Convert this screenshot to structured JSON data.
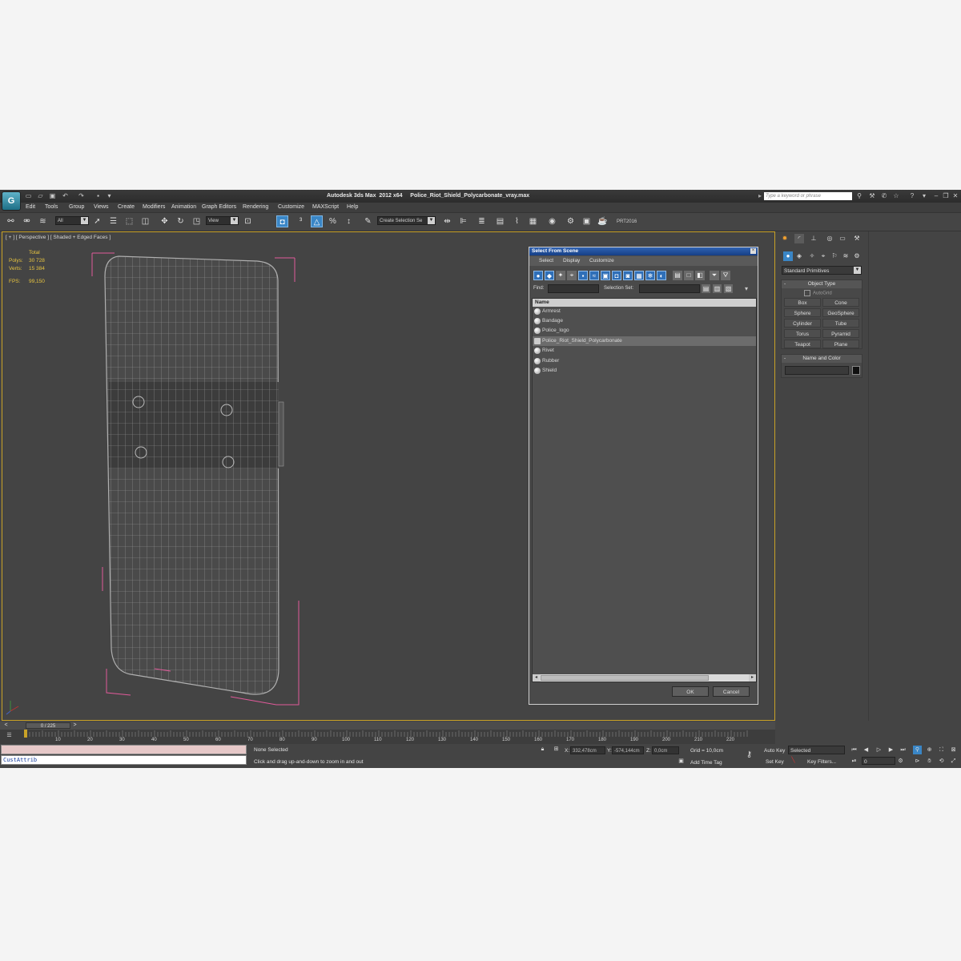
{
  "titlebar": {
    "app": "Autodesk 3ds Max  2012 x64",
    "file": "Police_Riot_Shield_Polycarbonate_vray.max",
    "search_placeholder": "Type a keyword or phrase"
  },
  "menu": [
    "Edit",
    "Tools",
    "Group",
    "Views",
    "Create",
    "Modifiers",
    "Animation",
    "Graph Editors",
    "Rendering",
    "Customize",
    "MAXScript",
    "Help"
  ],
  "toolbar": {
    "filter": "All",
    "ref_coord": "View",
    "named_selection": "Create Selection Se",
    "plugin_label": "PRT2016"
  },
  "viewport": {
    "label": "[ + ] [ Perspective ] [ Shaded + Edged Faces ]",
    "stats": {
      "total_label": "Total",
      "polys_label": "Polys:",
      "polys_value": "30 728",
      "verts_label": "Verts:",
      "verts_value": "15 384",
      "fps_label": "FPS:",
      "fps_value": "99,150"
    }
  },
  "dialog": {
    "title": "Select From Scene",
    "menu": [
      "Select",
      "Display",
      "Customize"
    ],
    "find_label": "Find:",
    "selection_set_label": "Selection Set:",
    "column_header": "Name",
    "items": [
      {
        "name": "Armrest"
      },
      {
        "name": "Bandage"
      },
      {
        "name": "Police_logo"
      },
      {
        "name": "Police_Riot_Shield_Polycarbonate",
        "selected": true
      },
      {
        "name": "Rivet"
      },
      {
        "name": "Rubber"
      },
      {
        "name": "Shield"
      }
    ],
    "ok": "OK",
    "cancel": "Cancel"
  },
  "command_panel": {
    "category": "Standard Primitives",
    "object_type_title": "Object Type",
    "autogrid": "AutoGrid",
    "buttons": [
      "Box",
      "Cone",
      "Sphere",
      "GeoSphere",
      "Cylinder",
      "Tube",
      "Torus",
      "Pyramid",
      "Teapot",
      "Plane"
    ],
    "name_color_title": "Name and Color",
    "swatch_color": "#111111"
  },
  "timeline": {
    "slider": "0 / 225",
    "ticks": [
      "10",
      "20",
      "30",
      "40",
      "50",
      "60",
      "70",
      "80",
      "90",
      "100",
      "110",
      "120",
      "130",
      "140",
      "150",
      "160",
      "170",
      "180",
      "190",
      "200",
      "210",
      "220"
    ]
  },
  "status": {
    "listener": "CustAttrib",
    "selection": "None Selected",
    "prompt": "Click and drag up-and-down to zoom in and out",
    "x_label": "X:",
    "x": "332,478cm",
    "y_label": "Y:",
    "y": "-574,144cm",
    "z_label": "Z:",
    "z": "0,0cm",
    "grid": "Grid = 10,0cm",
    "add_time_tag": "Add Time Tag",
    "auto_key": "Auto Key",
    "set_key": "Set Key",
    "key_mode": "Selected",
    "key_filters": "Key Filters...",
    "frame": "0"
  },
  "colors": {
    "accent_blue": "#3a86c6",
    "viewport_border": "#c9a227",
    "stats_text": "#e8c540",
    "bbox_pink": "#e05a9a"
  }
}
